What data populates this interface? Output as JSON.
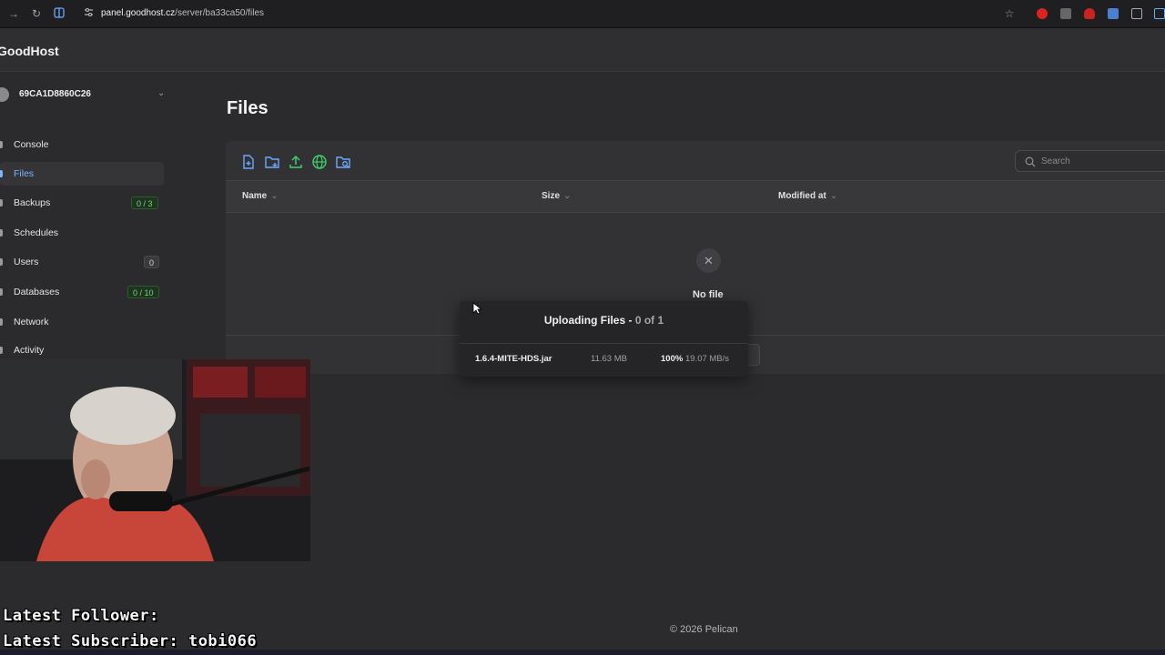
{
  "browser": {
    "url_host": "panel.goodhost.cz",
    "url_path": "/server/ba33ca50/files",
    "icons": [
      "forward-icon",
      "reload-icon",
      "split-view-icon",
      "site-info-icon",
      "bookmark-star-icon"
    ]
  },
  "app": {
    "brand": "GoodHost"
  },
  "server": {
    "name": "69CA1D8860C26"
  },
  "sidebar": {
    "items": [
      {
        "label": "Console",
        "badge": ""
      },
      {
        "label": "Files",
        "badge": "",
        "active": true
      },
      {
        "label": "Backups",
        "badge": "0 / 3"
      },
      {
        "label": "Schedules",
        "badge": ""
      },
      {
        "label": "Users",
        "badge": "0"
      },
      {
        "label": "Databases",
        "badge": "0 / 10"
      },
      {
        "label": "Network",
        "badge": ""
      },
      {
        "label": "Activity",
        "badge": ""
      }
    ]
  },
  "page": {
    "title": "Files"
  },
  "toolbar": {
    "icons": [
      "new-file-icon",
      "new-folder-icon",
      "upload-icon",
      "pull-remote-icon",
      "search-folder-icon"
    ],
    "search_placeholder": "Search"
  },
  "table": {
    "columns": [
      "Name",
      "Size",
      "Modified at"
    ],
    "empty_text": "No file"
  },
  "upload": {
    "title": "Uploading Files - ",
    "count": "0 of 1",
    "file": {
      "name": "1.6.4-MITE-HDS.jar",
      "size": "11.63 MB",
      "percent": "100%",
      "speed": "19.07 MB/s"
    }
  },
  "stream": {
    "follower_label": "Latest Follower:",
    "subscriber_label": "Latest Subscriber: tobi066"
  },
  "footer": {
    "copyright": "© 2026 Pelican"
  },
  "colors": {
    "accent": "#7cb4ff",
    "success": "#6fd58a",
    "icon_green": "#3ecf6b",
    "icon_blue": "#6aaaff"
  }
}
